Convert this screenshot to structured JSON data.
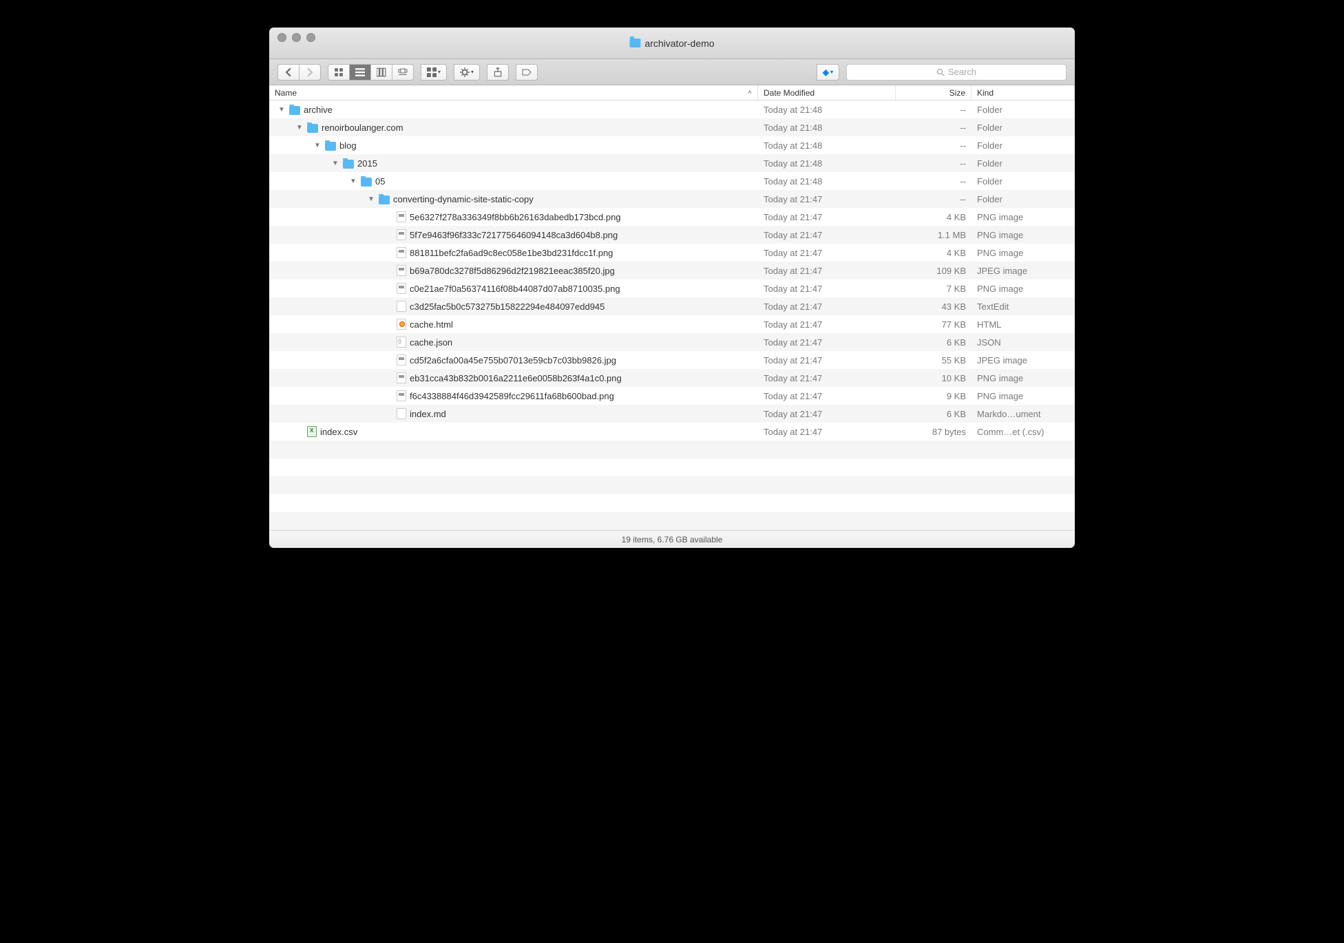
{
  "window": {
    "title": "archivator-demo"
  },
  "toolbar": {
    "search_placeholder": "Search"
  },
  "columns": {
    "name": "Name",
    "date": "Date Modified",
    "size": "Size",
    "kind": "Kind"
  },
  "rows": [
    {
      "indent": 0,
      "folder": true,
      "open": true,
      "icon": "folder",
      "name": "archive",
      "date": "Today at 21:48",
      "size": "--",
      "kind": "Folder"
    },
    {
      "indent": 1,
      "folder": true,
      "open": true,
      "icon": "folder",
      "name": "renoirboulanger.com",
      "date": "Today at 21:48",
      "size": "--",
      "kind": "Folder"
    },
    {
      "indent": 2,
      "folder": true,
      "open": true,
      "icon": "folder",
      "name": "blog",
      "date": "Today at 21:48",
      "size": "--",
      "kind": "Folder"
    },
    {
      "indent": 3,
      "folder": true,
      "open": true,
      "icon": "folder",
      "name": "2015",
      "date": "Today at 21:48",
      "size": "--",
      "kind": "Folder"
    },
    {
      "indent": 4,
      "folder": true,
      "open": true,
      "icon": "folder",
      "name": "05",
      "date": "Today at 21:48",
      "size": "--",
      "kind": "Folder"
    },
    {
      "indent": 5,
      "folder": true,
      "open": true,
      "icon": "folder",
      "name": "converting-dynamic-site-static-copy",
      "date": "Today at 21:47",
      "size": "--",
      "kind": "Folder"
    },
    {
      "indent": 6,
      "folder": false,
      "icon": "img",
      "name": "5e6327f278a336349f8bb6b26163dabedb173bcd.png",
      "date": "Today at 21:47",
      "size": "4 KB",
      "kind": "PNG image"
    },
    {
      "indent": 6,
      "folder": false,
      "icon": "img",
      "name": "5f7e9463f96f333c721775646094148ca3d604b8.png",
      "date": "Today at 21:47",
      "size": "1.1 MB",
      "kind": "PNG image"
    },
    {
      "indent": 6,
      "folder": false,
      "icon": "img",
      "name": "881811befc2fa6ad9c8ec058e1be3bd231fdcc1f.png",
      "date": "Today at 21:47",
      "size": "4 KB",
      "kind": "PNG image"
    },
    {
      "indent": 6,
      "folder": false,
      "icon": "img",
      "name": "b69a780dc3278f5d86296d2f219821eeac385f20.jpg",
      "date": "Today at 21:47",
      "size": "109 KB",
      "kind": "JPEG image"
    },
    {
      "indent": 6,
      "folder": false,
      "icon": "img",
      "name": "c0e21ae7f0a56374116f08b44087d07ab8710035.png",
      "date": "Today at 21:47",
      "size": "7 KB",
      "kind": "PNG image"
    },
    {
      "indent": 6,
      "folder": false,
      "icon": "txt",
      "name": "c3d25fac5b0c573275b15822294e484097edd945",
      "date": "Today at 21:47",
      "size": "43 KB",
      "kind": "TextEdit"
    },
    {
      "indent": 6,
      "folder": false,
      "icon": "html",
      "name": "cache.html",
      "date": "Today at 21:47",
      "size": "77 KB",
      "kind": "HTML"
    },
    {
      "indent": 6,
      "folder": false,
      "icon": "json",
      "name": "cache.json",
      "date": "Today at 21:47",
      "size": "6 KB",
      "kind": "JSON"
    },
    {
      "indent": 6,
      "folder": false,
      "icon": "img",
      "name": "cd5f2a6cfa00a45e755b07013e59cb7c03bb9826.jpg",
      "date": "Today at 21:47",
      "size": "55 KB",
      "kind": "JPEG image"
    },
    {
      "indent": 6,
      "folder": false,
      "icon": "img",
      "name": "eb31cca43b832b0016a2211e6e0058b263f4a1c0.png",
      "date": "Today at 21:47",
      "size": "10 KB",
      "kind": "PNG image"
    },
    {
      "indent": 6,
      "folder": false,
      "icon": "img",
      "name": "f6c4338884f46d3942589fcc29611fa68b600bad.png",
      "date": "Today at 21:47",
      "size": "9 KB",
      "kind": "PNG image"
    },
    {
      "indent": 6,
      "folder": false,
      "icon": "txt",
      "name": "index.md",
      "date": "Today at 21:47",
      "size": "6 KB",
      "kind": "Markdo…ument"
    },
    {
      "indent": 1,
      "folder": false,
      "icon": "csv",
      "name": "index.csv",
      "date": "Today at 21:47",
      "size": "87 bytes",
      "kind": "Comm…et (.csv)"
    }
  ],
  "empty_rows": 5,
  "status": "19 items, 6.76 GB available"
}
